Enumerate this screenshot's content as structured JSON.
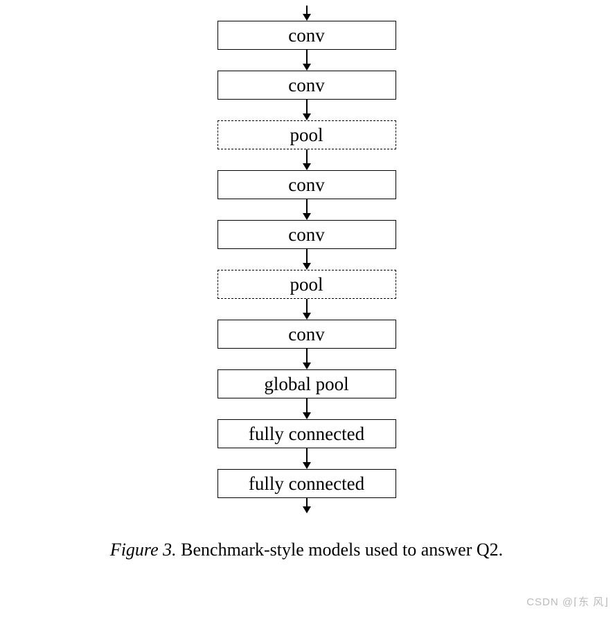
{
  "diagram": {
    "layers": [
      {
        "label": "conv",
        "style": "solid"
      },
      {
        "label": "conv",
        "style": "solid"
      },
      {
        "label": "pool",
        "style": "dashed"
      },
      {
        "label": "conv",
        "style": "solid"
      },
      {
        "label": "conv",
        "style": "solid"
      },
      {
        "label": "pool",
        "style": "dashed"
      },
      {
        "label": "conv",
        "style": "solid"
      },
      {
        "label": "global pool",
        "style": "solid"
      },
      {
        "label": "fully connected",
        "style": "solid"
      },
      {
        "label": "fully connected",
        "style": "solid"
      }
    ]
  },
  "caption": {
    "prefix": "Figure 3.",
    "text": " Benchmark-style models used to answer Q2."
  },
  "watermark": "CSDN @⌈东 风⌋"
}
